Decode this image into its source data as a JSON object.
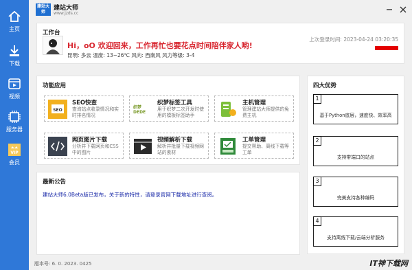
{
  "app": {
    "logo_text": "建站大师",
    "name": "建站大师",
    "url": "www.jzds.cc",
    "version": "版本号: 6. 0. 2023. 0425"
  },
  "nav": {
    "items": [
      {
        "label": "主页",
        "icon": "home-icon"
      },
      {
        "label": "下载",
        "icon": "download-icon"
      },
      {
        "label": "视频",
        "icon": "video-icon"
      },
      {
        "label": "服务器",
        "icon": "server-icon"
      },
      {
        "label": "会员",
        "icon": "vip-icon"
      }
    ]
  },
  "workbench": {
    "title": "工作台",
    "welcome": "Hi，oO 欢迎回来，工作再忙也要花点时间陪伴家人哟!",
    "weather": "昆明: 多云 温度: 13~26℃ 风向: 西南风 风力等级: 3-4",
    "last_login": "上次登录时间: 2023-04-24 03:20:35"
  },
  "functions": {
    "title": "功能应用",
    "tiles": [
      {
        "name": "SEO快查",
        "desc": "查询站点收录情况和实时排名情况",
        "icon": "seo-icon"
      },
      {
        "name": "织梦标签工具",
        "desc": "用于织梦二次开发时使用的模板标签助手",
        "icon": "dedecms-icon"
      },
      {
        "name": "主机管理",
        "desc": "管理建站大师提供的免费主机",
        "icon": "host-icon"
      },
      {
        "name": "网页图片下载",
        "desc": "分析并下载网页和CSS中的图片",
        "icon": "code-icon"
      },
      {
        "name": "视频解析下载",
        "desc": "解析并批量下载视频网站的素材",
        "icon": "video-play-icon"
      },
      {
        "name": "工单管理",
        "desc": "提交帮助、离线下载等工单",
        "icon": "ticket-icon"
      }
    ],
    "dede_logo_text": "织梦DEDE"
  },
  "notice": {
    "title": "最新公告",
    "text": "建站大师6.0Beta版已发布，关于新的特性，请登录官网下载地址进行查阅。"
  },
  "advantages": {
    "title": "四大优势",
    "items": [
      {
        "num": "1",
        "text": "基于Python底层，速度快、效率高"
      },
      {
        "num": "2",
        "text": "支持带端口的站点"
      },
      {
        "num": "3",
        "text": "完美支持各种编码"
      },
      {
        "num": "4",
        "text": "支持离线下载/云端分析服务"
      }
    ]
  },
  "watermark": "IT神下载网",
  "colors": {
    "nav": "#2f78d8",
    "accent_red": "#d8262f",
    "notice_blue": "#1a2aa8"
  }
}
